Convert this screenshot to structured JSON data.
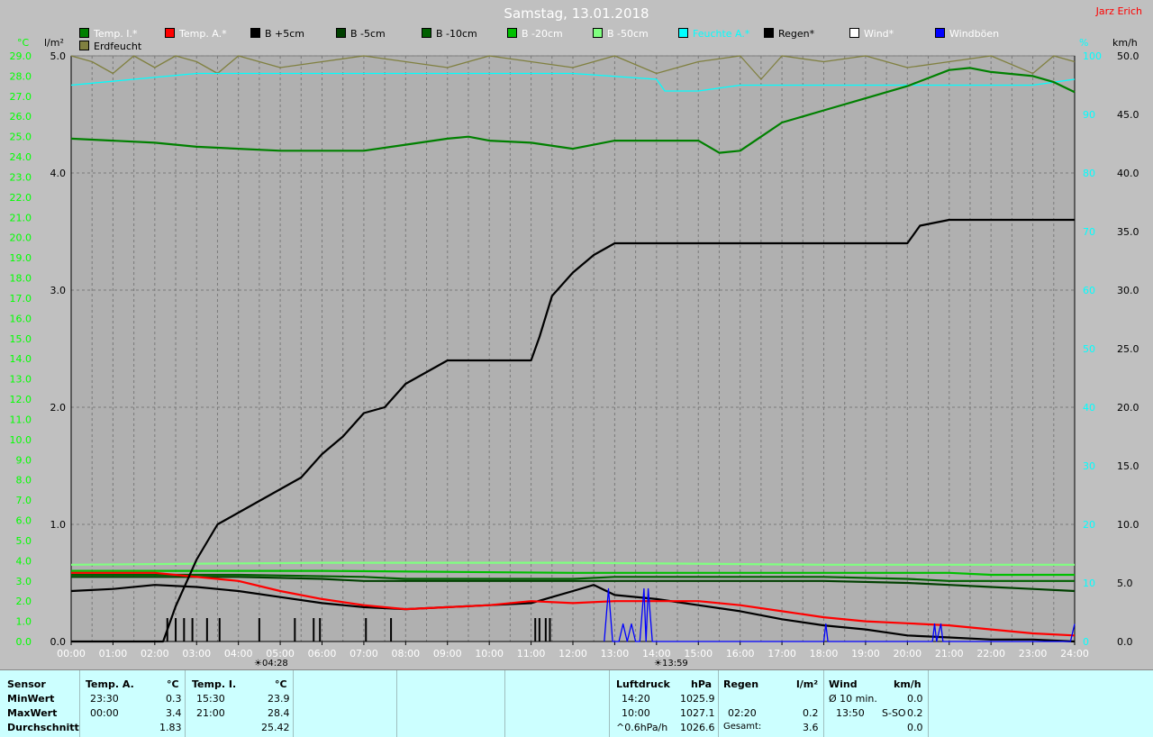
{
  "title": "Samstag, 13.01.2018",
  "author": "Jarz Erich",
  "legend": [
    {
      "label": "Temp. I.*",
      "color": "#008000"
    },
    {
      "label": "Temp. A.*",
      "color": "#ff0000"
    },
    {
      "label": "B +5cm",
      "color": "#000000"
    },
    {
      "label": "B -5cm",
      "color": "#004000"
    },
    {
      "label": "B -10cm",
      "color": "#006000"
    },
    {
      "label": "B -20cm",
      "color": "#00c000"
    },
    {
      "label": "B -50cm",
      "color": "#80ff80"
    },
    {
      "label": "Feuchte A.*",
      "color": "#00ffff"
    },
    {
      "label": "Regen*",
      "color": "#000000"
    },
    {
      "label": "Wind*",
      "color": "#ffffff"
    },
    {
      "label": "Windböen",
      "color": "#0000ff"
    },
    {
      "label": "Erdfeucht",
      "color": "#808040"
    }
  ],
  "units": {
    "temp": "°C",
    "rain": "l/m²",
    "humidity": "%",
    "wind": "km/h"
  },
  "markers": {
    "sunrise": "04:28",
    "sunset": "13:59"
  },
  "chart_data": {
    "type": "line",
    "x_ticks": [
      "00:00",
      "01:00",
      "02:00",
      "03:00",
      "04:00",
      "05:00",
      "06:00",
      "07:00",
      "08:00",
      "09:00",
      "10:00",
      "11:00",
      "12:00",
      "13:00",
      "14:00",
      "15:00",
      "16:00",
      "17:00",
      "18:00",
      "19:00",
      "20:00",
      "21:00",
      "22:00",
      "23:00",
      "24:00"
    ],
    "axes": {
      "temp": {
        "min": 0.0,
        "max": 29.0,
        "step": 1.0,
        "ticks": [
          "0.0",
          "1.0",
          "2.0",
          "3.0",
          "4.0",
          "5.0",
          "6.0",
          "7.0",
          "8.0",
          "9.0",
          "10.0",
          "11.0",
          "12.0",
          "13.0",
          "14.0",
          "15.0",
          "16.0",
          "17.0",
          "18.0",
          "19.0",
          "20.0",
          "21.0",
          "22.0",
          "23.0",
          "24.0",
          "25.0",
          "26.0",
          "27.0",
          "28.0",
          "29.0"
        ]
      },
      "rain": {
        "min": 0.0,
        "max": 5.0,
        "ticks": [
          "0.0",
          "1.0",
          "2.0",
          "3.0",
          "4.0",
          "5.0"
        ]
      },
      "humidity": {
        "min": 0,
        "max": 100,
        "ticks": [
          "0",
          "10",
          "20",
          "30",
          "40",
          "50",
          "60",
          "70",
          "80",
          "90",
          "100"
        ]
      },
      "wind": {
        "min": 0.0,
        "max": 50.0,
        "ticks": [
          "0.0",
          "5.0",
          "10.0",
          "15.0",
          "20.0",
          "25.0",
          "30.0",
          "35.0",
          "40.0",
          "45.0",
          "50.0"
        ]
      }
    },
    "series": [
      {
        "name": "Temp. I.*",
        "axis": "temp",
        "color": "#008000",
        "x": [
          0,
          1,
          2,
          3,
          4,
          5,
          6,
          7,
          8,
          9,
          9.5,
          10,
          11,
          12,
          13,
          14,
          15,
          15.5,
          16,
          16.5,
          17,
          18,
          19,
          20,
          21,
          21.5,
          22,
          23,
          23.5,
          24
        ],
        "y": [
          24.9,
          24.8,
          24.7,
          24.5,
          24.4,
          24.3,
          24.3,
          24.3,
          24.6,
          24.9,
          25.0,
          24.8,
          24.7,
          24.4,
          24.8,
          24.8,
          24.8,
          24.2,
          24.3,
          25.0,
          25.7,
          26.3,
          26.9,
          27.5,
          28.3,
          28.4,
          28.2,
          28.0,
          27.7,
          27.2
        ]
      },
      {
        "name": "Temp. A.*",
        "axis": "temp",
        "color": "#ff0000",
        "x": [
          0,
          1,
          2,
          3,
          4,
          5,
          6,
          7,
          8,
          9,
          10,
          11,
          12,
          13,
          14,
          15,
          16,
          17,
          18,
          19,
          20,
          21,
          22,
          23,
          24
        ],
        "y": [
          3.4,
          3.4,
          3.4,
          3.2,
          3.0,
          2.5,
          2.1,
          1.8,
          1.6,
          1.7,
          1.8,
          2.0,
          1.9,
          2.0,
          2.0,
          2.0,
          1.8,
          1.5,
          1.2,
          1.0,
          0.9,
          0.8,
          0.6,
          0.4,
          0.3
        ]
      },
      {
        "name": "B +5cm",
        "axis": "temp",
        "color": "#000000",
        "x": [
          0,
          1,
          2,
          3,
          4,
          5,
          6,
          7,
          8,
          9,
          10,
          11,
          11.5,
          12,
          12.5,
          13,
          14,
          15,
          16,
          17,
          18,
          19,
          20,
          21,
          22,
          23,
          24
        ],
        "y": [
          2.5,
          2.6,
          2.8,
          2.7,
          2.5,
          2.2,
          1.9,
          1.7,
          1.6,
          1.7,
          1.8,
          1.9,
          2.2,
          2.5,
          2.8,
          2.3,
          2.1,
          1.8,
          1.5,
          1.1,
          0.8,
          0.6,
          0.3,
          0.2,
          0.1,
          0.1,
          0.0
        ]
      },
      {
        "name": "B -5cm",
        "axis": "temp",
        "color": "#004000",
        "x": [
          0,
          3,
          4,
          6,
          7,
          8,
          10,
          12,
          14,
          16,
          18,
          20,
          21,
          22,
          23,
          24
        ],
        "y": [
          3.2,
          3.2,
          3.2,
          3.1,
          3.0,
          3.0,
          3.0,
          3.0,
          3.0,
          3.0,
          3.0,
          2.9,
          2.8,
          2.7,
          2.6,
          2.5
        ]
      },
      {
        "name": "B -10cm",
        "axis": "temp",
        "color": "#006000",
        "x": [
          0,
          4,
          7,
          8,
          12,
          13,
          18,
          20,
          21,
          24
        ],
        "y": [
          3.3,
          3.3,
          3.2,
          3.1,
          3.1,
          3.2,
          3.2,
          3.1,
          3.0,
          3.0
        ]
      },
      {
        "name": "B -20cm",
        "axis": "temp",
        "color": "#00c000",
        "x": [
          0,
          6,
          12,
          18,
          21,
          22,
          24
        ],
        "y": [
          3.5,
          3.5,
          3.4,
          3.4,
          3.4,
          3.3,
          3.3
        ]
      },
      {
        "name": "B -50cm",
        "axis": "temp",
        "color": "#80ff80",
        "x": [
          0,
          6,
          12,
          18,
          24
        ],
        "y": [
          3.8,
          3.9,
          3.9,
          3.8,
          3.8
        ]
      },
      {
        "name": "Feuchte A.*",
        "axis": "humidity",
        "color": "#00ffff",
        "x": [
          0,
          3,
          6,
          9,
          12,
          14,
          14.2,
          15,
          16,
          18,
          20,
          22,
          23,
          24
        ],
        "y": [
          95,
          97,
          97,
          97,
          97,
          96,
          94,
          94,
          95,
          95,
          95,
          95,
          95,
          96
        ]
      },
      {
        "name": "Regen*",
        "axis": "rain",
        "color": "#000000",
        "x": [
          0,
          2.2,
          2.5,
          3,
          3.5,
          4,
          4.5,
          5,
          5.5,
          6,
          6.5,
          7,
          7.5,
          8,
          9,
          10,
          11,
          11.2,
          11.5,
          12,
          12.5,
          13,
          14,
          17,
          20,
          20.3,
          21,
          22,
          24
        ],
        "y": [
          0,
          0,
          0.3,
          0.7,
          1.0,
          1.1,
          1.2,
          1.3,
          1.4,
          1.6,
          1.75,
          1.95,
          2.0,
          2.2,
          2.4,
          2.4,
          2.4,
          2.6,
          2.95,
          3.15,
          3.3,
          3.4,
          3.4,
          3.4,
          3.4,
          3.55,
          3.6,
          3.6,
          3.6
        ]
      },
      {
        "name": "Windböen",
        "axis": "wind",
        "color": "#0000ff",
        "x": [
          12.75,
          12.85,
          12.95,
          13.1,
          13.2,
          13.3,
          13.4,
          13.5,
          13.6,
          13.7,
          13.75,
          13.8,
          13.9,
          13.95,
          18.0,
          18.05,
          18.1,
          20.6,
          20.65,
          20.7,
          20.8,
          20.85,
          20.9,
          23.9,
          24
        ],
        "y": [
          0,
          4.5,
          0,
          0,
          1.5,
          0,
          1.5,
          0,
          0,
          4.5,
          0,
          4.5,
          0,
          0,
          0,
          1.5,
          0,
          0,
          1.5,
          0,
          1.5,
          0,
          0,
          0,
          1.5
        ]
      },
      {
        "name": "Erdfeucht",
        "axis": "humidity",
        "color": "#808040",
        "x": [
          0,
          0.5,
          1,
          1.5,
          2,
          2.5,
          3,
          3.5,
          4,
          5,
          6,
          7,
          8,
          9,
          10,
          11,
          12,
          13,
          14,
          15,
          16,
          16.5,
          17,
          18,
          19,
          20,
          21,
          22,
          23,
          23.5,
          24
        ],
        "y": [
          100,
          99,
          97,
          100,
          98,
          100,
          99,
          97,
          100,
          98,
          99,
          100,
          99,
          98,
          100,
          99,
          98,
          100,
          97,
          99,
          100,
          96,
          100,
          99,
          100,
          98,
          99,
          100,
          97,
          100,
          99
        ]
      }
    ],
    "rain_bars": {
      "x": [
        2.3,
        2.5,
        2.7,
        2.9,
        3.25,
        3.55,
        4.5,
        5.35,
        5.8,
        5.95,
        7.05,
        7.65,
        11.1,
        11.2,
        11.35,
        11.45
      ],
      "axis": "rain",
      "value": 0.2
    },
    "grid": true
  },
  "stats": {
    "sensor_header": "Sensor",
    "rows": [
      "MinWert",
      "MaxWert",
      "Durchschnitt"
    ],
    "temp_a": {
      "header": "Temp. A.",
      "unit": "°C",
      "min_time": "23:30",
      "min": "0.3",
      "max_time": "00:00",
      "max": "3.4",
      "avg": "1.83"
    },
    "temp_i": {
      "header": "Temp. I.",
      "unit": "°C",
      "min_time": "15:30",
      "min": "23.9",
      "max_time": "21:00",
      "max": "28.4",
      "avg": "25.42"
    },
    "pressure": {
      "header": "Luftdruck",
      "unit": "hPa",
      "min_time": "14:20",
      "min": "1025.9",
      "max_time": "10:00",
      "max": "1027.1",
      "trend": "^0.6hPa/h",
      "avg": "1026.6"
    },
    "rain": {
      "header": "Regen",
      "unit": "l/m²",
      "max_time": "02:20",
      "max": "0.2",
      "total_label": "Gesamt:",
      "total": "3.6"
    },
    "wind": {
      "header": "Wind",
      "unit": "km/h",
      "avg_label": "Ø 10 min.",
      "avg": "0.0",
      "max_time": "13:50",
      "dir": "S-SO",
      "max": "0.2",
      "avg2": "0.0"
    }
  }
}
